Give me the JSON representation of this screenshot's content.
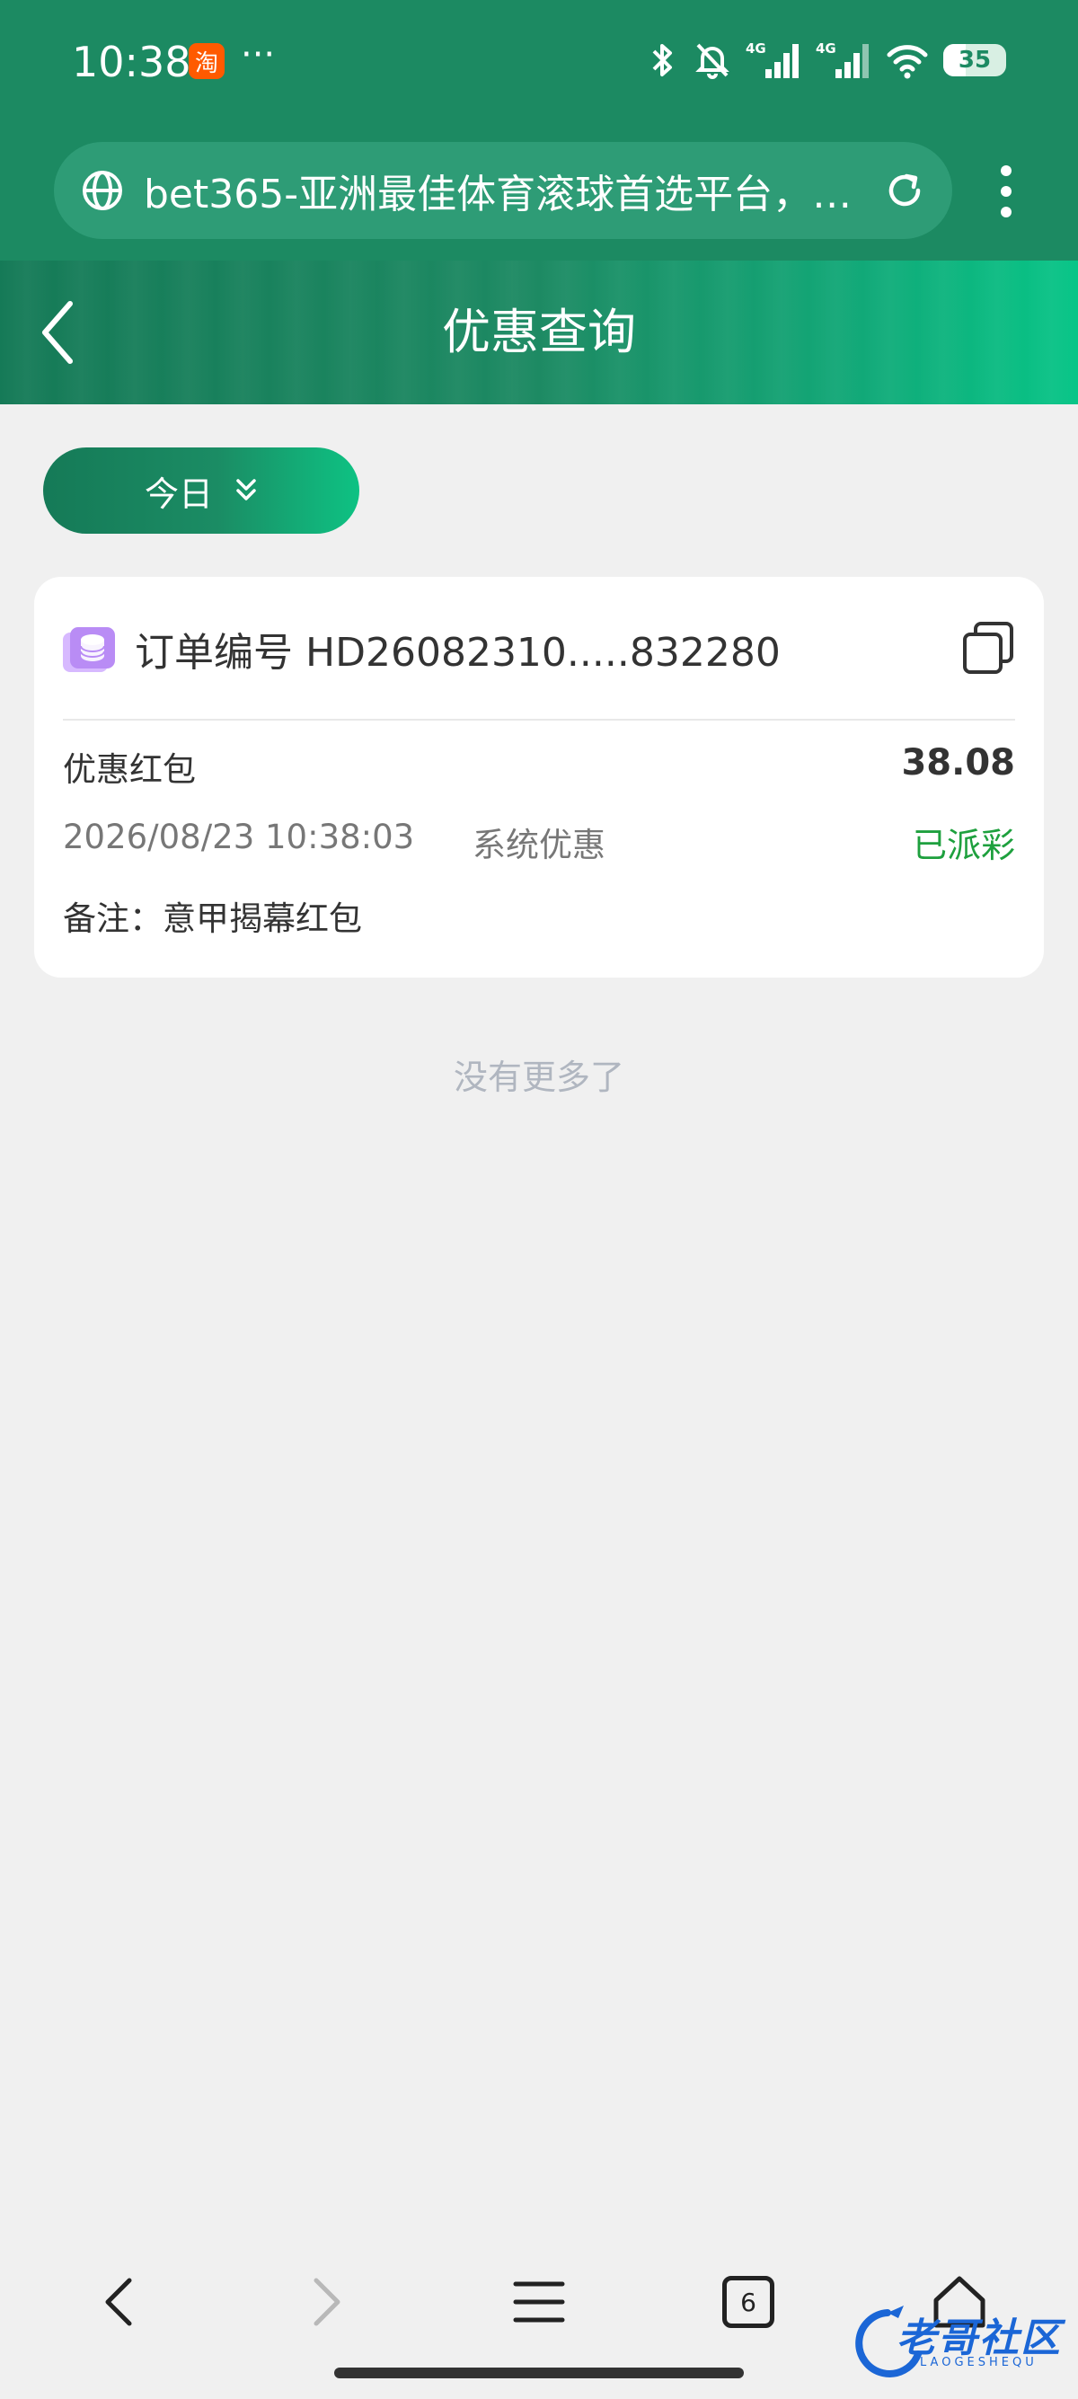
{
  "status_bar": {
    "time": "10:38",
    "app_icon_glyph": "淘",
    "more": "···",
    "battery": "35",
    "battery_level": 0.35,
    "network_1": "4G",
    "network_2": "4G"
  },
  "browser": {
    "address_text": "bet365-亚洲最佳体育滚球首选平台，…",
    "tab_count": "6"
  },
  "header": {
    "title": "优惠查询"
  },
  "filter": {
    "date_label": "今日"
  },
  "record": {
    "order_prefix": "订单编号",
    "order_number": "HD26082310.....832280",
    "type": "优惠红包",
    "amount": "38.08",
    "datetime": "2026/08/23 10:38:03",
    "source": "系统优惠",
    "status": "已派彩",
    "note": "备注：意甲揭幕红包"
  },
  "list_footer": "没有更多了",
  "watermark": {
    "text": "老哥社区",
    "sub": "LAOGESHEQU"
  },
  "colors": {
    "brand_green": "#1c8a62",
    "status_green": "#1ea03e",
    "watermark_blue": "#1b66d6"
  }
}
